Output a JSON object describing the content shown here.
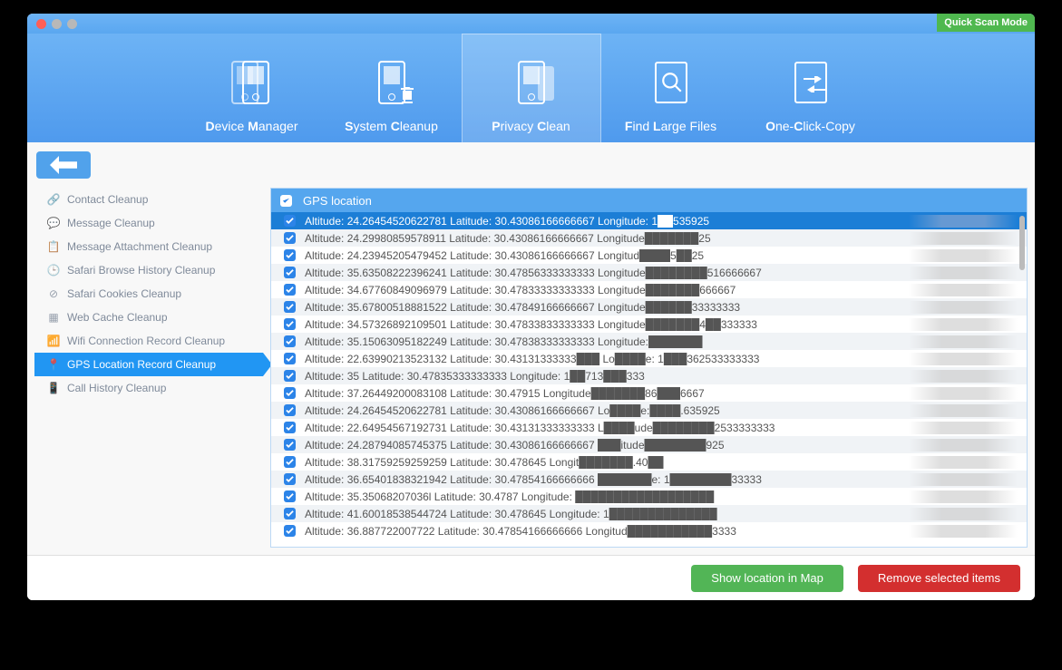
{
  "quick_mode": "Quick Scan Mode",
  "tabs": [
    {
      "pre": "D",
      "mid": "evice ",
      "b2": "M",
      "post": "anager"
    },
    {
      "pre": "S",
      "mid": "ystem ",
      "b2": "C",
      "post": "leanup"
    },
    {
      "pre": "P",
      "mid": "rivacy ",
      "b2": "C",
      "post": "lean"
    },
    {
      "pre": "F",
      "mid": "ind ",
      "b2": "L",
      "post": "arge Files"
    },
    {
      "pre": "O",
      "mid": "ne-",
      "b2": "C",
      "post": "lick-Copy"
    }
  ],
  "active_tab": 2,
  "sidebar": [
    "Contact Cleanup",
    "Message Cleanup",
    "Message Attachment Cleanup",
    "Safari Browse History Cleanup",
    "Safari Cookies Cleanup",
    "Web Cache Cleanup",
    "Wifi Connection Record Cleanup",
    "GPS Location Record Cleanup",
    "Call History Cleanup"
  ],
  "sidebar_active": 7,
  "list_header": "GPS location",
  "rows": [
    "Altitude: 24.26454520622781  Latitude: 30.43086166666667  Longitude: 1██535925",
    "Altitude: 24.29980859578911  Latitude: 30.43086166666667  Longitude███████25",
    "Altitude: 24.23945205479452  Latitude: 30.43086166666667  Longitud████5██25",
    "Altitude: 35.63508222396241  Latitude: 30.47856333333333  Longitude████████516666667",
    "Altitude: 34.67760849096979  Latitude: 30.47833333333333  Longitude███████666667",
    "Altitude: 35.67800518881522  Latitude: 30.47849166666667  Longitude██████33333333",
    "Altitude: 34.57326892109501  Latitude: 30.47833833333333  Longitude███████4██333333",
    "Altitude: 35.15063095182249  Latitude: 30.47838333333333  Longitude:███████",
    "Altitude: 22.63990213523132  Latitude: 30.43131333333███ Lo████e: 1███362533333333",
    "Altitude: 35   Latitude: 30.47835333333333  Longitude: 1██713███333",
    "Altitude: 37.26449200083108  Latitude: 30.47915  Longitude███████86███6667",
    "Altitude: 24.26454520622781  Latitude: 30.43086166666667  Lo████e:████.635925",
    "Altitude: 22.64954567192731  Latitude: 30.43131333333333  L████ude████████2533333333",
    "Altitude: 24.28794085745375  Latitude: 30.43086166666667  ███itude████████925",
    "Altitude: 38.31759259259259  Latitude: 30.478645  Longit███████.40██",
    "Altitude: 36.65401838321942  Latitude: 30.47854166666666  ███████e: 1████████33333",
    "Altitude: 35.35068207036l  Latitude: 30.4787  Longitude: ██████████████████",
    "Altitude: 41.60018538544724  Latitude: 30.478645  Longitude: 1██████████████",
    "Altitude: 36.887722007722  Latitude: 30.47854166666666  Longitud███████████3333"
  ],
  "selected_row": 0,
  "btn_map": "Show location in Map",
  "btn_remove": "Remove selected items"
}
